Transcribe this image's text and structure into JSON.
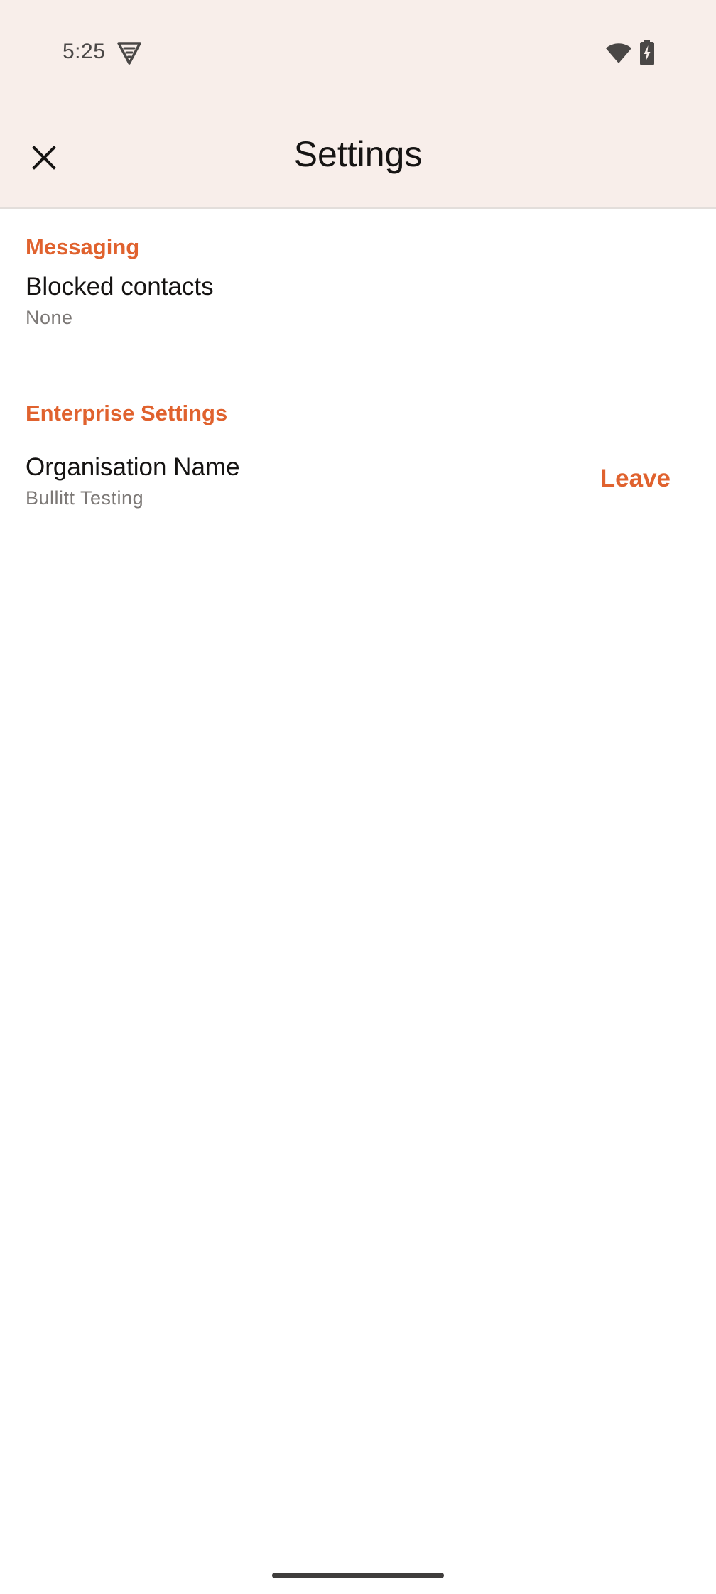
{
  "status_bar": {
    "time": "5:25",
    "icons": [
      "vpn-shield-icon",
      "wifi-icon",
      "battery-charging-icon"
    ]
  },
  "app_bar": {
    "title": "Settings",
    "close_icon": "close-icon"
  },
  "sections": [
    {
      "header": "Messaging",
      "items": [
        {
          "title": "Blocked contacts",
          "summary": "None"
        }
      ]
    },
    {
      "header": "Enterprise Settings",
      "items": [
        {
          "title": "Organisation Name",
          "summary": "Bullitt Testing",
          "action_label": "Leave"
        }
      ]
    }
  ],
  "colors": {
    "accent": "#e0622e",
    "header_background": "#f8eeea",
    "title_text": "#151312",
    "summary_text": "#7c7876"
  }
}
